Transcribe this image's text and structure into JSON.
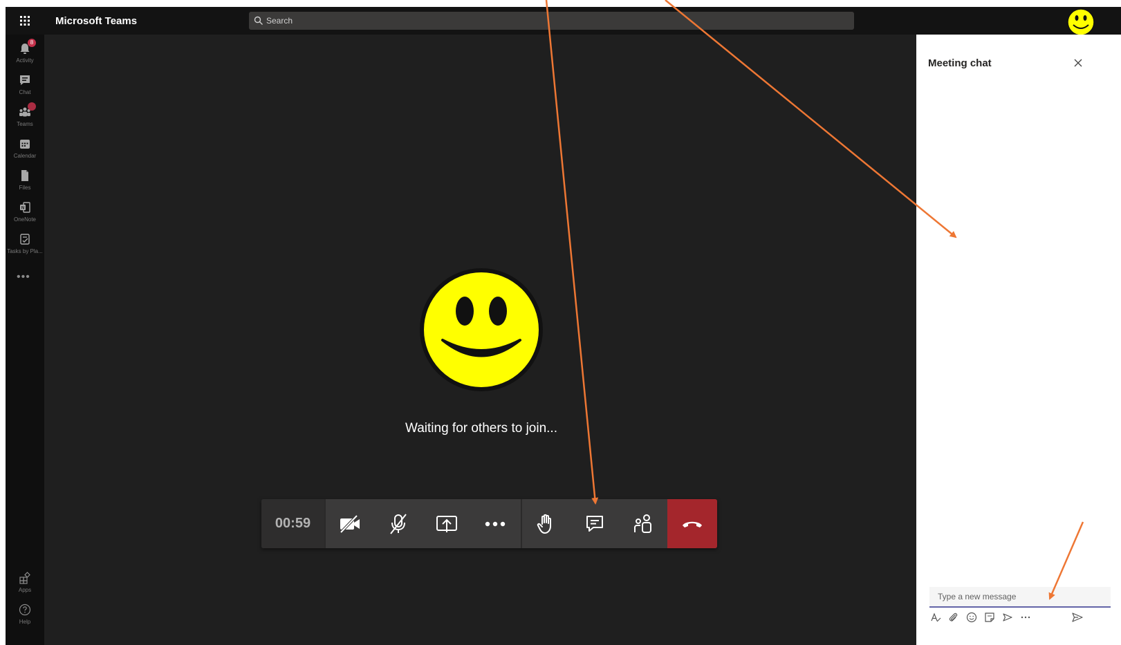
{
  "app": {
    "title": "Microsoft Teams"
  },
  "search": {
    "placeholder": "Search"
  },
  "rail": {
    "items": [
      {
        "label": "Activity",
        "badge": "8"
      },
      {
        "label": "Chat"
      },
      {
        "label": "Teams"
      },
      {
        "label": "Calendar"
      },
      {
        "label": "Files"
      },
      {
        "label": "OneNote"
      },
      {
        "label": "Tasks by Pla..."
      }
    ],
    "more": "•••",
    "bottom": [
      {
        "label": "Apps"
      },
      {
        "label": "Help"
      }
    ]
  },
  "stage": {
    "waiting_text": "Waiting for others to join..."
  },
  "controls": {
    "timer": "00:59",
    "buttons": [
      "camera-off-icon",
      "mic-muted-icon",
      "share-tray-icon",
      "more-actions-icon",
      "raise-hand-icon",
      "chat-icon",
      "participants-icon",
      "hang-up-icon"
    ]
  },
  "chat": {
    "title": "Meeting chat",
    "compose_placeholder": "Type a new message",
    "tools": [
      "format-icon",
      "attach-icon",
      "emoji-icon",
      "sticker-icon",
      "praise-icon",
      "more-options-icon",
      "send-icon"
    ]
  },
  "colors": {
    "topbar": "#131313",
    "stage": "#1f1f1f",
    "hangup": "#a4262c",
    "accent": "#6264a7",
    "annotation_arrow": "#ee7734",
    "smiley": "#ffff00"
  }
}
